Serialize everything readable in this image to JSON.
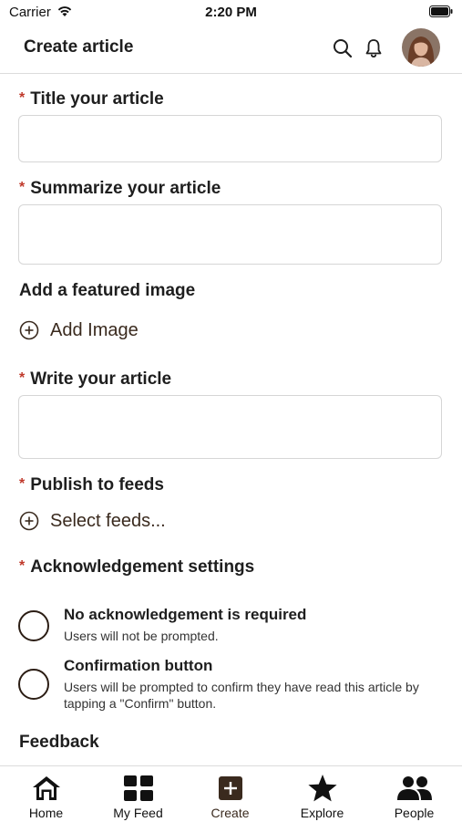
{
  "status_bar": {
    "carrier": "Carrier",
    "time": "2:20 PM"
  },
  "header": {
    "title": "Create article"
  },
  "form": {
    "title_label": "Title your article",
    "summary_label": "Summarize your article",
    "image_label": "Add a featured image",
    "add_image": "Add Image",
    "body_label": "Write your article",
    "feeds_label": "Publish to feeds",
    "select_feeds": "Select feeds...",
    "ack_label": "Acknowledgement settings",
    "ack_options": [
      {
        "title": "No acknowledgement is required",
        "desc": "Users will not be prompted."
      },
      {
        "title": "Confirmation button",
        "desc": "Users will be prompted to confirm they have read this article by tapping a \"Confirm\" button."
      }
    ],
    "feedback_label": "Feedback"
  },
  "tabs": [
    {
      "label": "Home",
      "icon": "home-icon"
    },
    {
      "label": "My Feed",
      "icon": "grid-icon"
    },
    {
      "label": "Create",
      "icon": "plus-square-icon",
      "active": true
    },
    {
      "label": "Explore",
      "icon": "star-icon"
    },
    {
      "label": "People",
      "icon": "people-icon"
    }
  ],
  "colors": {
    "accent": "#3a2a1e",
    "required": "#c0392b",
    "border": "#d6d6d6"
  }
}
